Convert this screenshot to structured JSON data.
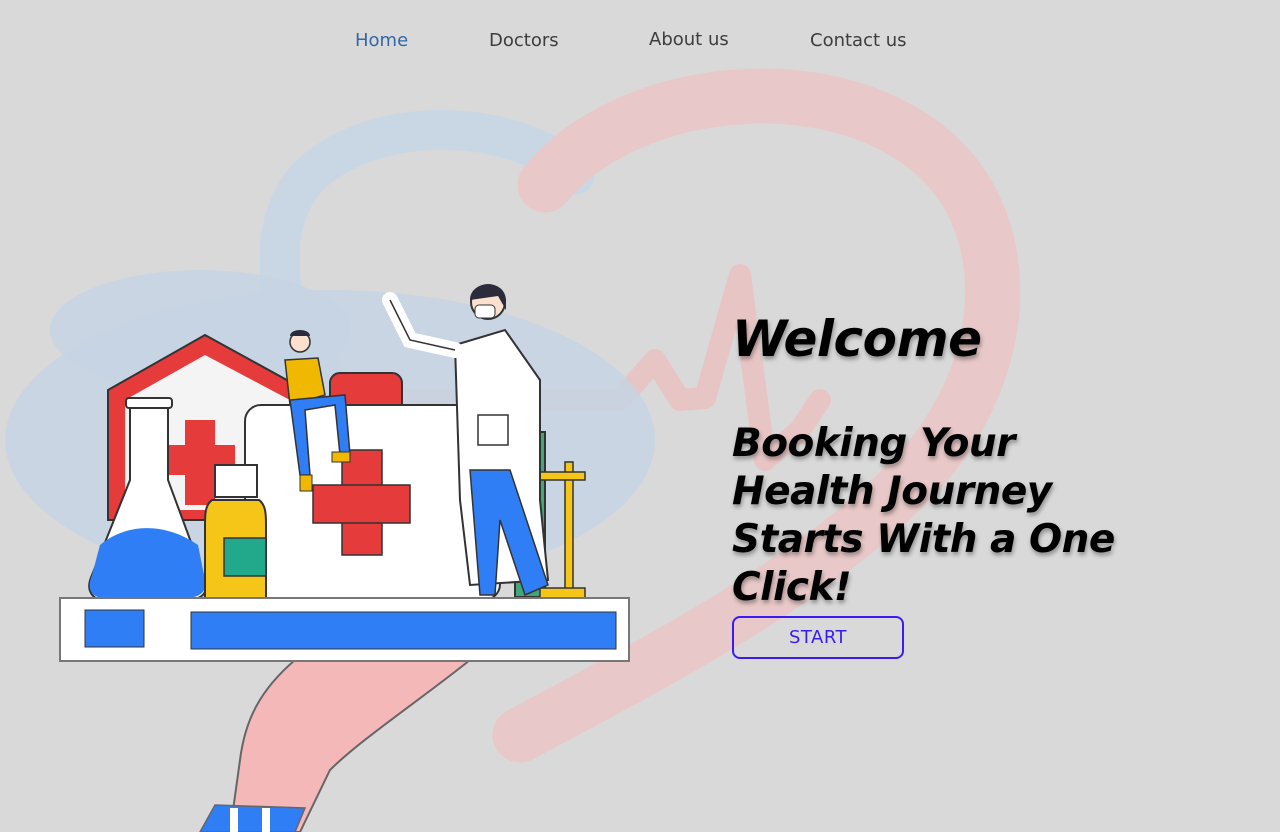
{
  "nav": {
    "items": [
      {
        "label": "Home",
        "active": true
      },
      {
        "label": "Doctors",
        "active": false
      },
      {
        "label": "About us",
        "active": false
      },
      {
        "label": "Contact us",
        "active": false
      }
    ]
  },
  "hero": {
    "title": "Welcome",
    "tagline": "Booking Your Health Journey Starts With a One Click!",
    "start_label": "START"
  },
  "colors": {
    "background": "#d9d9d9",
    "nav_active": "#2f6aa6",
    "nav_text": "#3d3d3d",
    "button_accent": "#3b1cf0",
    "logo_red": "#e8c6c6",
    "logo_blue": "#c5d4e3"
  },
  "icons": {
    "background_logo": "heart-pulse-logo-icon",
    "illustration": "medical-tray-illustration"
  }
}
